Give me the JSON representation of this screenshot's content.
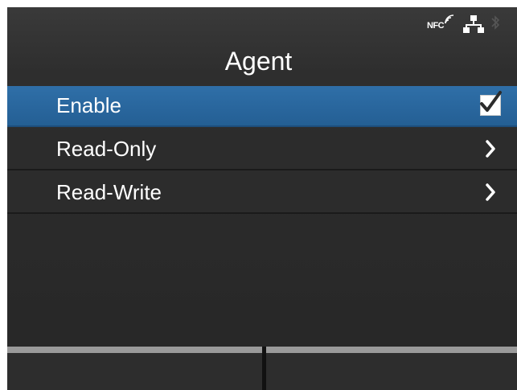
{
  "status": {
    "nfc_label": "NFC",
    "icons": [
      "nfc-icon",
      "network-icon",
      "bluetooth-icon"
    ]
  },
  "header": {
    "title": "Agent"
  },
  "menu": {
    "items": [
      {
        "label": "Enable",
        "control": "checkbox",
        "checked": true,
        "selected": true
      },
      {
        "label": "Read-Only",
        "control": "chevron"
      },
      {
        "label": "Read-Write",
        "control": "chevron"
      }
    ]
  },
  "colors": {
    "selected_row": "#2f6fa8",
    "background": "#2e2e2e",
    "softkey_bar": "#9a9a9a"
  },
  "softkeys": {
    "left_label": "",
    "right_label": ""
  }
}
